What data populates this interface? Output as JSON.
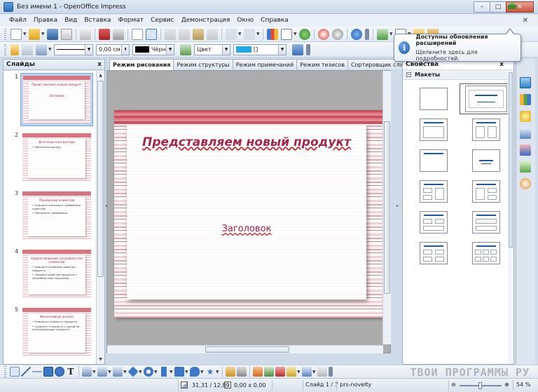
{
  "window": {
    "title": "Без имени 1 - OpenOffice Impress",
    "minimize": "–",
    "maximize": "□",
    "close": "✕"
  },
  "menu": {
    "items": [
      "Файл",
      "Правка",
      "Вид",
      "Вставка",
      "Формат",
      "Сервис",
      "Демонстрация",
      "Окно",
      "Справка"
    ],
    "close_doc": "✕"
  },
  "toolbar2": {
    "line_width": "0,00 см",
    "line_color": "Чёрнь",
    "line_color_hex": "#000000",
    "fill_type": "Цвет",
    "fill_color": "[]",
    "fill_color_hex": "#1fa8e8"
  },
  "notification": {
    "title": "Доступны обновления расширений",
    "text": "Щелкните здесь для подробностей.",
    "icon": "i"
  },
  "slides_pane": {
    "title": "Слайды",
    "close": "x",
    "slides": [
      {
        "number": "1",
        "title": "Представляем новый продукт",
        "subtitle": "Заголовок",
        "bullets": []
      },
      {
        "number": "2",
        "title": "Долгосрочная выгода",
        "subtitle": "",
        "bullets": [
          "Объяснить выгоду"
        ]
      },
      {
        "number": "3",
        "title": "Понимание клиентов",
        "subtitle": "",
        "bullets": [
          "Опишите желания и требования клиентов",
          "Объясните требования"
        ]
      },
      {
        "number": "4",
        "title": "Удовлетворение потребностей клиентов",
        "subtitle": "",
        "bullets": [
          "Опишите основные свойства продукта",
          "Свяжите свойства продукта с потребностями заказчика"
        ]
      },
      {
        "number": "5",
        "title": "Финансовый анализ",
        "subtitle": "",
        "bullets": [
          "Опишите стоимость продукта",
          "Сравните стоимость с ценой на конкурирующие продукты"
        ]
      }
    ]
  },
  "view_tabs": [
    "Режим рисования",
    "Режим структуры",
    "Режим примечаний",
    "Режим тезисов",
    "Сортировщик слайдов"
  ],
  "main_slide": {
    "title": "Представляем новый продукт",
    "subtitle": "Заголовок"
  },
  "properties": {
    "title": "Свойства",
    "close": "x",
    "section": "Макеты",
    "collapse": "−"
  },
  "drawbar": {
    "watermark": "ТВОИ ПРОГРАММЫ РУ"
  },
  "status": {
    "position": "31,31 / 12,89",
    "size": "0,00 x 0,00",
    "slide": "Слайд 1 / 7",
    "design": "prs-novelty",
    "zoom": "54 %",
    "zoom_fraction": 0.54
  }
}
